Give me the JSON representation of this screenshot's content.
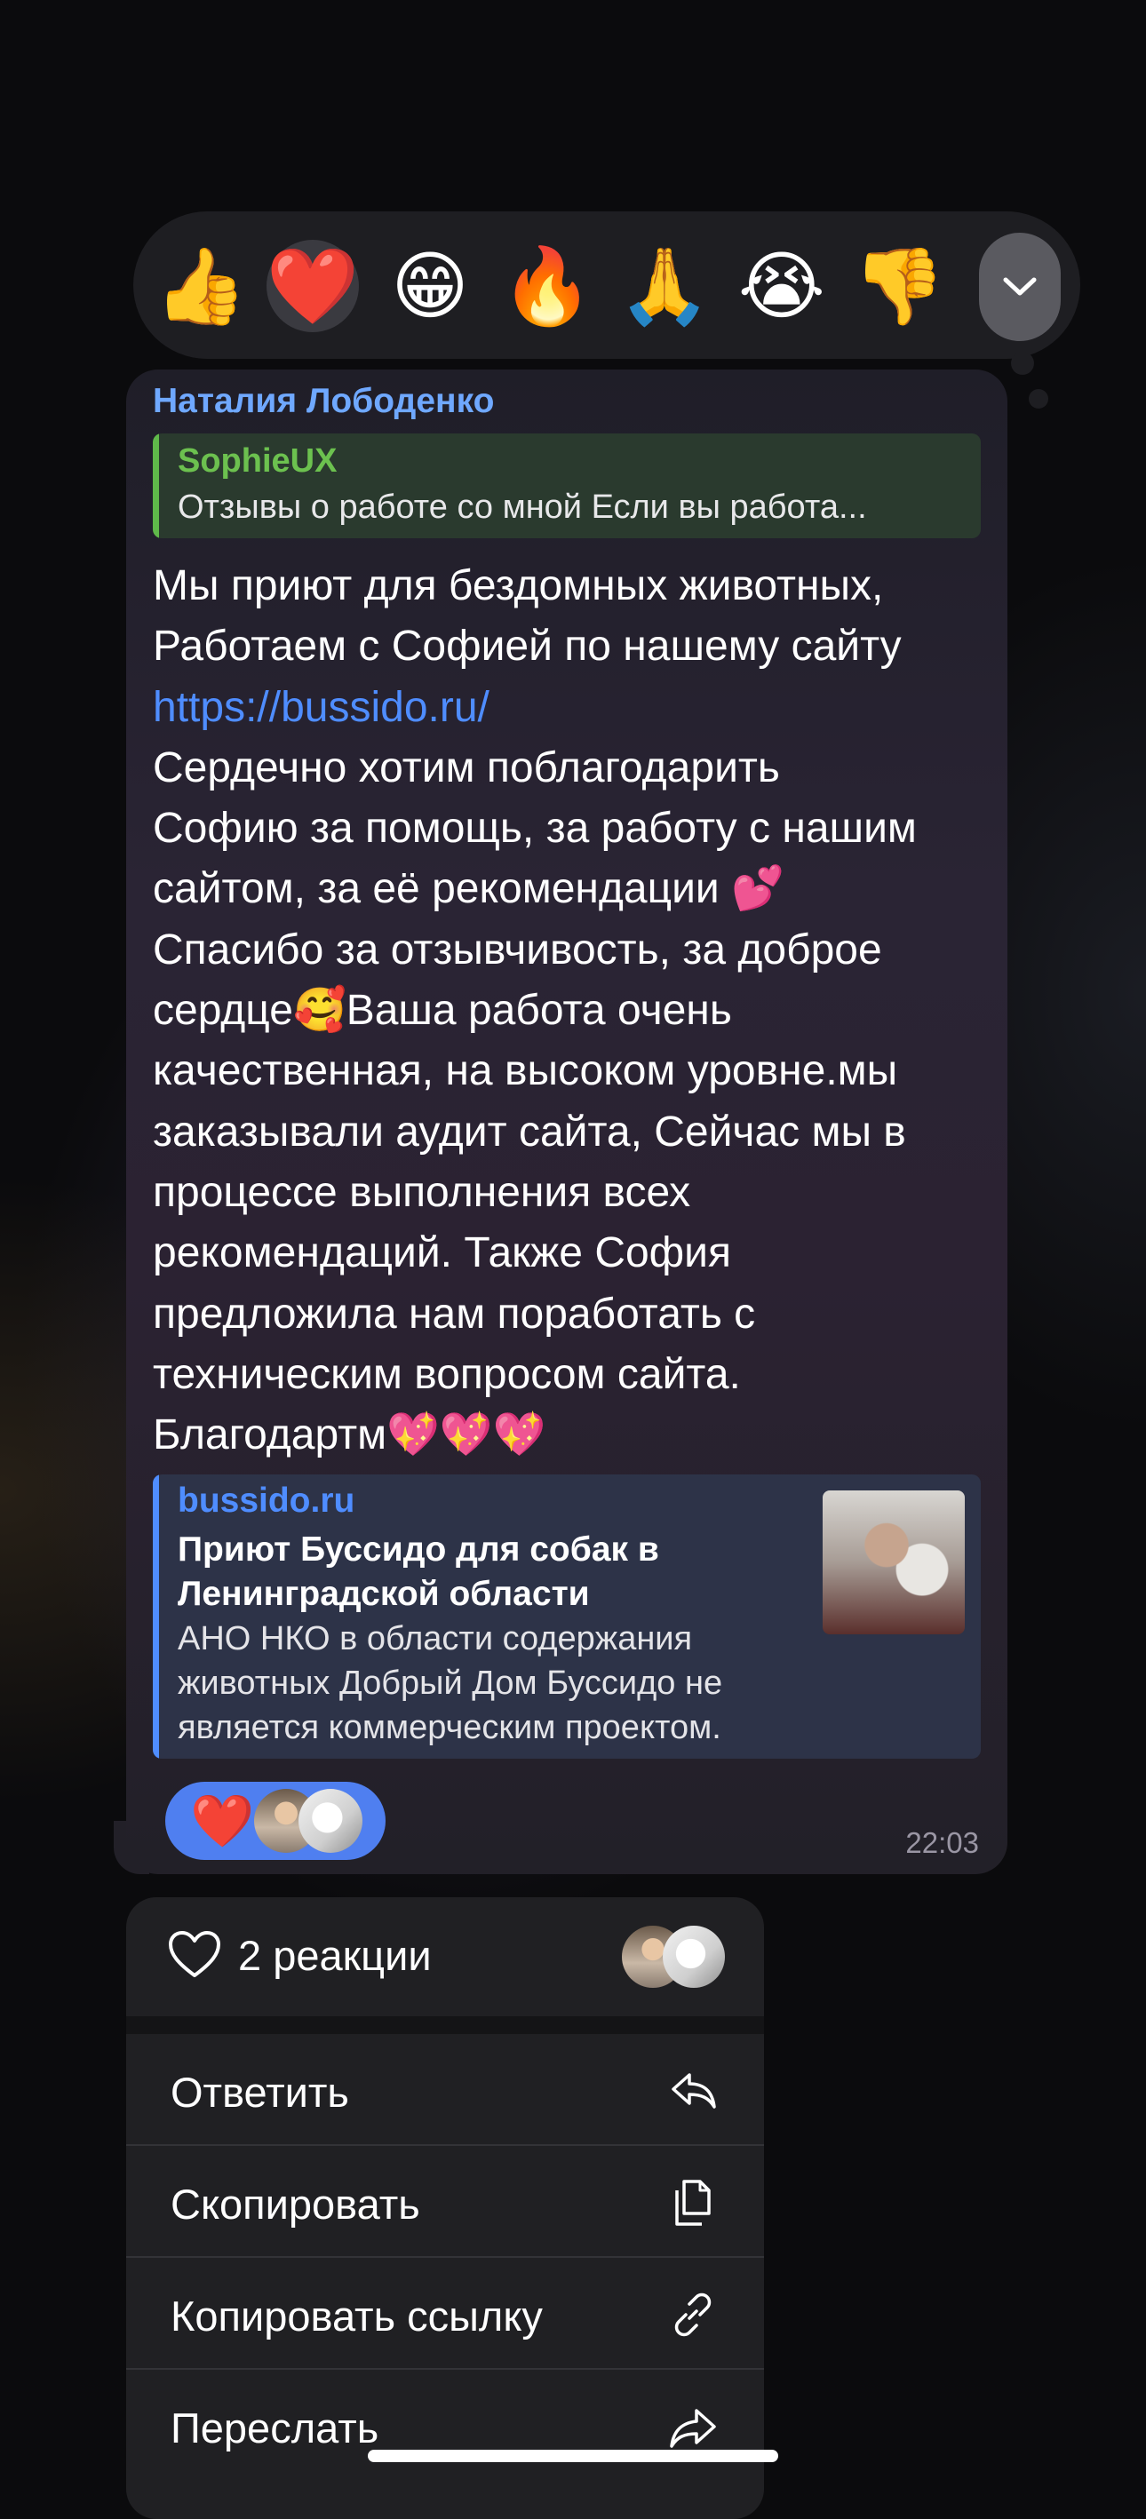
{
  "reactions": [
    {
      "emoji": "👍",
      "name": "thumbs-up"
    },
    {
      "emoji": "❤️",
      "name": "heart",
      "selected": true
    },
    {
      "emoji": "😁",
      "name": "grin"
    },
    {
      "emoji": "🔥",
      "name": "fire"
    },
    {
      "emoji": "🙏",
      "name": "pray"
    },
    {
      "emoji": "😭",
      "name": "cry"
    },
    {
      "emoji": "👎",
      "name": "thumbs-down"
    }
  ],
  "message": {
    "sender": "Наталия Лободенко",
    "reply": {
      "author": "SophieUX",
      "text": "Отзывы о работе со мной Если вы работа..."
    },
    "lines": [
      "Мы приют для бездомных животных,",
      "Работаем с Софией по нашему сайту",
      "https://bussido.ru/",
      "Сердечно хотим поблагодарить",
      "Софию за помощь, за работу с нашим",
      "сайтом, за её рекомендации 💕",
      "Спасибо за отзывчивость, за доброе",
      "сердце🥰Ваша работа очень",
      "качественная, на высоком уровне.мы",
      "заказывали аудит сайта, Сейчас мы в",
      "процессе выполнения всех",
      "рекомендаций. Также София",
      "предложила нам поработать с",
      "техническим вопросом сайта.",
      "Благодартм💖💖💖"
    ],
    "link_preview": {
      "site": "bussido.ru",
      "title": "Приют Буссидо для собак в Ленинградской области",
      "description": "АНО НКО в области содержания животных Добрый Дом Буссидо не является коммерческим проектом."
    },
    "reaction_pill": {
      "emoji": "❤️"
    },
    "time": "22:03"
  },
  "menu": {
    "reactions_summary": "2 реакции",
    "items": [
      {
        "label": "Ответить",
        "icon": "reply-icon"
      },
      {
        "label": "Скопировать",
        "icon": "copy-icon"
      },
      {
        "label": "Копировать ссылку",
        "icon": "link-icon"
      },
      {
        "label": "Переслать",
        "icon": "forward-icon"
      }
    ]
  },
  "colors": {
    "accent": "#4f8dff",
    "sender": "#6fa8ff",
    "reply_author": "#6cc14f"
  }
}
